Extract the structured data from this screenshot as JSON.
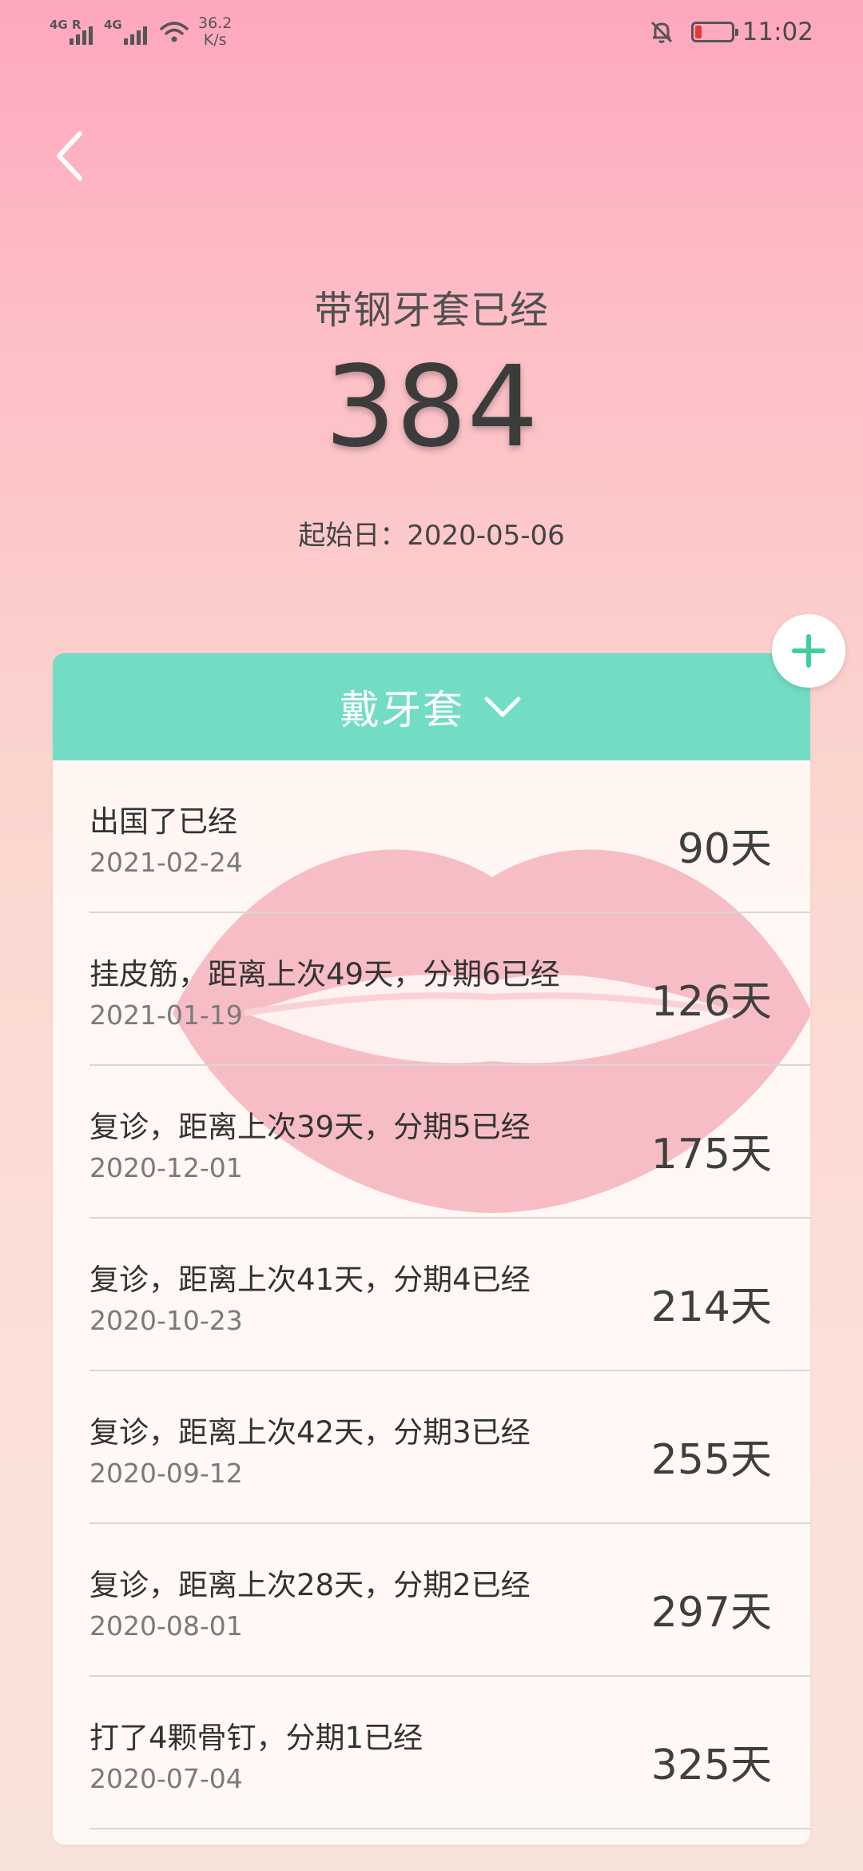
{
  "status_bar": {
    "net1_label": "4G R",
    "net2_label": "4G",
    "speed_value": "36.2",
    "speed_unit": "K/s",
    "battery_color": "#e53935",
    "time": "11:02"
  },
  "header": {
    "back_icon": "chevron-left-icon",
    "title": "带钢牙套已经",
    "count": "384",
    "start_date": "起始日：2020-05-06"
  },
  "card": {
    "header_title": "戴牙套",
    "header_icon": "chevron-down-icon",
    "accent_color": "#73dcc5",
    "items": [
      {
        "title": "出国了已经",
        "date": "2021-02-24",
        "days": "90天"
      },
      {
        "title": "挂皮筋，距离上次49天，分期6已经",
        "date": "2021-01-19",
        "days": "126天"
      },
      {
        "title": "复诊，距离上次39天，分期5已经",
        "date": "2020-12-01",
        "days": "175天"
      },
      {
        "title": "复诊，距离上次41天，分期4已经",
        "date": "2020-10-23",
        "days": "214天"
      },
      {
        "title": "复诊，距离上次42天，分期3已经",
        "date": "2020-09-12",
        "days": "255天"
      },
      {
        "title": "复诊，距离上次28天，分期2已经",
        "date": "2020-08-01",
        "days": "297天"
      },
      {
        "title": "打了4颗骨钉，分期1已经",
        "date": "2020-07-04",
        "days": "325天"
      }
    ]
  },
  "add_button": {
    "icon": "plus-icon",
    "color": "#3fcf9f"
  }
}
